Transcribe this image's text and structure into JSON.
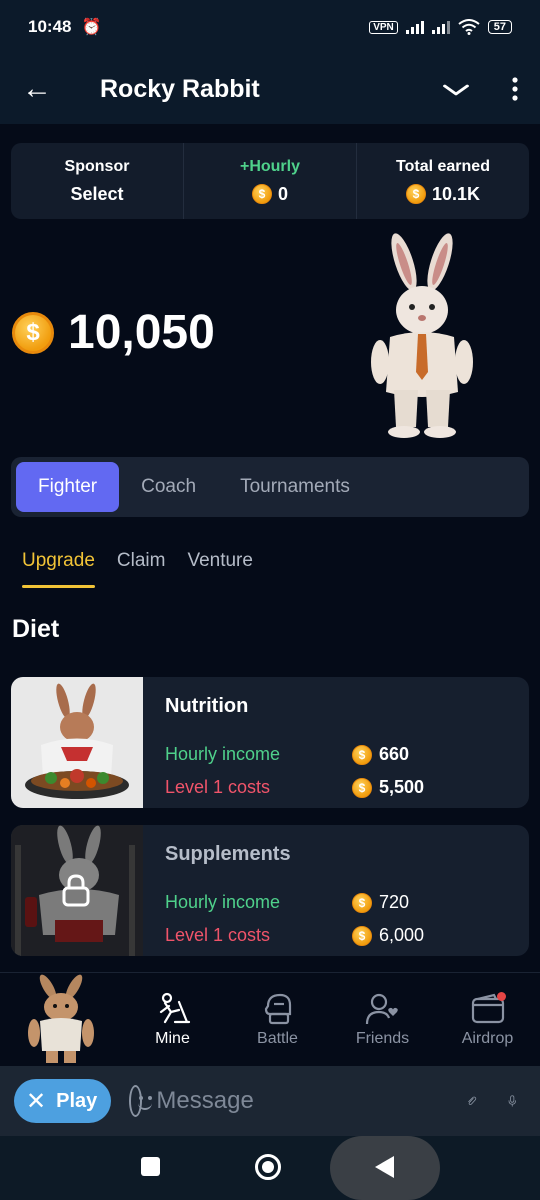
{
  "status": {
    "time": "10:48",
    "vpn": "VPN",
    "battery": "57"
  },
  "header": {
    "title": "Rocky Rabbit"
  },
  "stats": [
    {
      "label": "Sponsor",
      "value": "Select",
      "coin": false
    },
    {
      "label": "+Hourly",
      "value": "0",
      "coin": true
    },
    {
      "label": "Total earned",
      "value": "10.1K",
      "coin": true
    }
  ],
  "balance": "10,050",
  "main_tabs": [
    "Fighter",
    "Coach",
    "Tournaments"
  ],
  "active_main_tab": "Fighter",
  "sub_tabs": [
    "Upgrade",
    "Claim",
    "Venture"
  ],
  "active_sub_tab": "Upgrade",
  "section_title": "Diet",
  "cards": [
    {
      "title": "Nutrition",
      "income_label": "Hourly income",
      "income": "660",
      "cost_label": "Level 1 costs",
      "cost": "5,500",
      "locked": false
    },
    {
      "title": "Supplements",
      "income_label": "Hourly income",
      "income": "720",
      "cost_label": "Level 1 costs",
      "cost": "6,000",
      "locked": true
    }
  ],
  "nav": [
    "Mine",
    "Battle",
    "Friends",
    "Airdrop"
  ],
  "active_nav": "Mine",
  "composer": {
    "play_label": "Play",
    "placeholder": "Message"
  },
  "icons": {
    "coin": "$",
    "back": "←",
    "dropdown": "chevron-down",
    "more": "vertical-dots"
  },
  "colors": {
    "accent": "#6269f2",
    "green": "#4fd18b",
    "red": "#f0546a",
    "gold": "#f2c437",
    "coin": "#f5a623"
  }
}
